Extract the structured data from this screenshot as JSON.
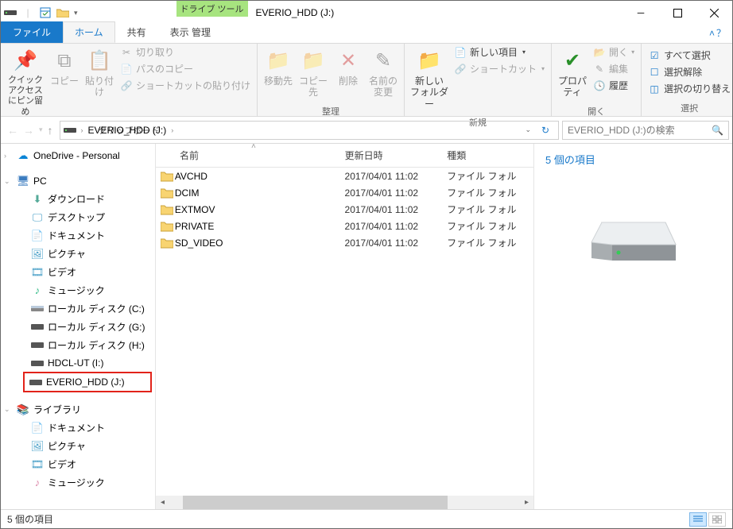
{
  "window": {
    "title": "EVERIO_HDD (J:)",
    "context_tab": "ドライブ ツール",
    "context_sub": "管理"
  },
  "tabs": {
    "file": "ファイル",
    "home": "ホーム",
    "share": "共有",
    "view": "表示"
  },
  "ribbon": {
    "clipboard": {
      "label": "クリップボード",
      "pin": "クイック アクセス\nにピン留め",
      "copy": "コピー",
      "paste": "貼り付け",
      "cut": "切り取り",
      "copypath": "パスのコピー",
      "pasteshortcut": "ショートカットの貼り付け"
    },
    "organize": {
      "label": "整理",
      "moveto": "移動先",
      "copyto": "コピー先",
      "delete": "削除",
      "rename": "名前の\n変更"
    },
    "new": {
      "label": "新規",
      "newfolder": "新しい\nフォルダー",
      "newitem": "新しい項目",
      "shortcut": "ショートカット"
    },
    "open": {
      "label": "開く",
      "properties": "プロパ\nティ",
      "open": "開く",
      "edit": "編集",
      "history": "履歴"
    },
    "select": {
      "label": "選択",
      "selectall": "すべて選択",
      "selectnone": "選択解除",
      "invert": "選択の切り替え"
    }
  },
  "address": {
    "root": "",
    "current": "EVERIO_HDD (J:)"
  },
  "search": {
    "placeholder": "EVERIO_HDD (J:)の検索"
  },
  "nav": {
    "onedrive": "OneDrive - Personal",
    "pc": "PC",
    "pc_items": [
      "ダウンロード",
      "デスクトップ",
      "ドキュメント",
      "ピクチャ",
      "ビデオ",
      "ミュージック",
      "ローカル ディスク (C:)",
      "ローカル ディスク (G:)",
      "ローカル ディスク (H:)",
      "HDCL-UT (I:)",
      "EVERIO_HDD (J:)"
    ],
    "libraries": "ライブラリ",
    "lib_items": [
      "ドキュメント",
      "ピクチャ",
      "ビデオ",
      "ミュージック"
    ]
  },
  "columns": {
    "name": "名前",
    "date": "更新日時",
    "type": "種類"
  },
  "files": [
    {
      "name": "AVCHD",
      "date": "2017/04/01 11:02",
      "type": "ファイル フォル"
    },
    {
      "name": "DCIM",
      "date": "2017/04/01 11:02",
      "type": "ファイル フォル"
    },
    {
      "name": "EXTMOV",
      "date": "2017/04/01 11:02",
      "type": "ファイル フォル"
    },
    {
      "name": "PRIVATE",
      "date": "2017/04/01 11:02",
      "type": "ファイル フォル"
    },
    {
      "name": "SD_VIDEO",
      "date": "2017/04/01 11:02",
      "type": "ファイル フォル"
    }
  ],
  "details": {
    "count": "5 個の項目"
  },
  "status": {
    "text": "5 個の項目"
  }
}
